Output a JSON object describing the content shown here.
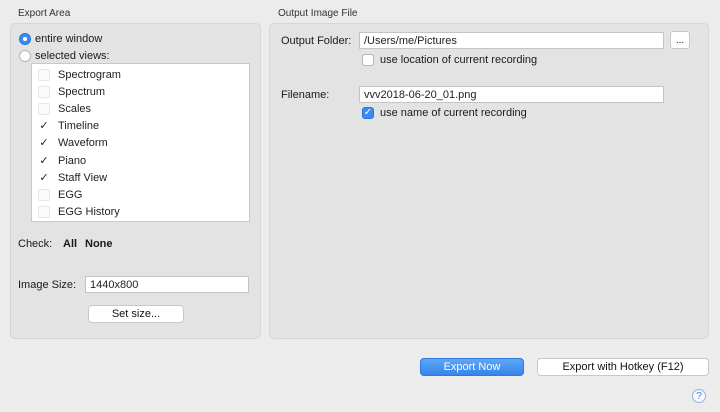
{
  "export_area": {
    "title": "Export Area",
    "entire_window_label": "entire window",
    "selected_views_label": "selected views:",
    "views": [
      {
        "label": "Spectrogram",
        "checked": false
      },
      {
        "label": "Spectrum",
        "checked": false
      },
      {
        "label": "Scales",
        "checked": false
      },
      {
        "label": "Timeline",
        "checked": true
      },
      {
        "label": "Waveform",
        "checked": true
      },
      {
        "label": "Piano",
        "checked": true
      },
      {
        "label": "Staff View",
        "checked": true
      },
      {
        "label": "EGG",
        "checked": false
      },
      {
        "label": "EGG History",
        "checked": false
      }
    ],
    "check_label": "Check:",
    "all_label": "All",
    "none_label": "None",
    "image_size_label": "Image Size:",
    "image_size_value": "1440x800",
    "set_size_label": "Set size..."
  },
  "output_file": {
    "title": "Output Image File",
    "folder_label": "Output Folder:",
    "folder_value": "/Users/me/Pictures",
    "browse_label": "...",
    "use_location_label": "use location of current recording",
    "filename_label": "Filename:",
    "filename_value": "vvv2018-06-20_01.png",
    "use_name_label": "use name of current recording"
  },
  "footer": {
    "export_now_label": "Export Now",
    "export_hotkey_label": "Export with Hotkey (F12)",
    "help_label": "?"
  },
  "check_mark": "✓",
  "colors": {
    "accent": "#3b8cf0",
    "background": "#ececec",
    "panel": "#e3e3e3"
  }
}
